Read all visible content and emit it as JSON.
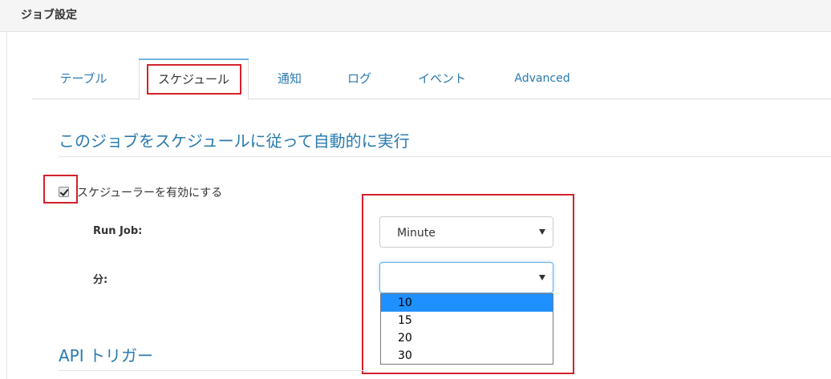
{
  "header": {
    "title": "ジョブ設定"
  },
  "tabs": [
    {
      "label": "テーブル",
      "active": false
    },
    {
      "label": "スケジュール",
      "active": true
    },
    {
      "label": "通知",
      "active": false
    },
    {
      "label": "ログ",
      "active": false
    },
    {
      "label": "イベント",
      "active": false
    },
    {
      "label": "Advanced",
      "active": false
    }
  ],
  "schedule": {
    "title": "このジョブをスケジュールに従って自動的に実行",
    "enable_label": "スケジューラーを有効にする",
    "enable_checked": true,
    "run_job_label": "Run Job:",
    "run_job_value": "Minute",
    "minute_label": "分:",
    "minute_value": "",
    "minute_options": [
      "10",
      "15",
      "20",
      "30"
    ],
    "minute_highlighted": "10"
  },
  "api": {
    "title": "API トリガー"
  },
  "colors": {
    "accent": "#2a7ab0",
    "highlight_box": "#d4212b",
    "option_highlight": "#1e90ff"
  }
}
